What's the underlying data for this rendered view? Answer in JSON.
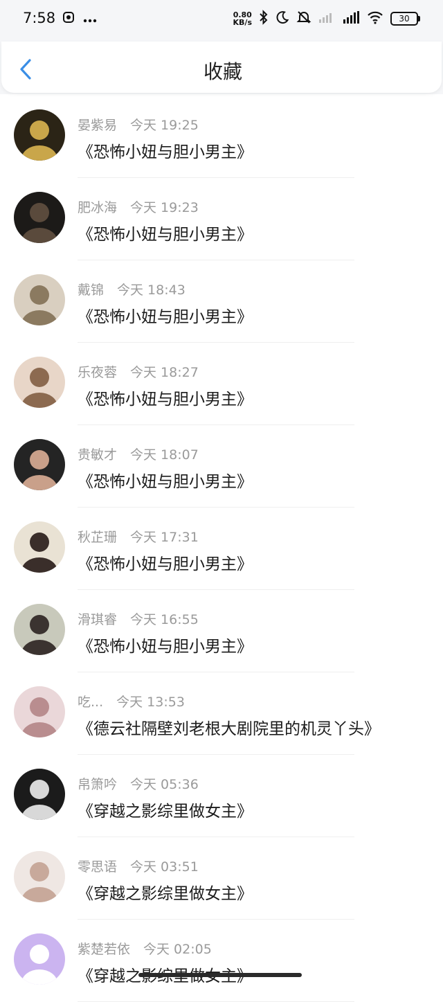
{
  "status_bar": {
    "time": "7:58",
    "net_speed_value": "0.80",
    "net_speed_unit": "KB/s",
    "battery": "30"
  },
  "header": {
    "title": "收藏",
    "back_icon": "chevron-left-icon",
    "accent": "#3a8ee6"
  },
  "favorites": [
    {
      "user": "晏紫易",
      "time": "今天 19:25",
      "book": "《恐怖小妞与胆小男主》",
      "avatar_color": "#2b2416",
      "avatar_accent": "#c9a64a"
    },
    {
      "user": "肥冰海",
      "time": "今天 19:23",
      "book": "《恐怖小妞与胆小男主》",
      "avatar_color": "#1c1a18",
      "avatar_accent": "#5a4a3c"
    },
    {
      "user": "戴锦",
      "time": "今天 18:43",
      "book": "《恐怖小妞与胆小男主》",
      "avatar_color": "#d9cfc0",
      "avatar_accent": "#8b7a60"
    },
    {
      "user": "乐夜蓉",
      "time": "今天 18:27",
      "book": "《恐怖小妞与胆小男主》",
      "avatar_color": "#e8d6c8",
      "avatar_accent": "#8c6a50"
    },
    {
      "user": "贵敏才",
      "time": "今天 18:07",
      "book": "《恐怖小妞与胆小男主》",
      "avatar_color": "#242424",
      "avatar_accent": "#c9a08a"
    },
    {
      "user": "秋芷珊",
      "time": "今天 17:31",
      "book": "《恐怖小妞与胆小男主》",
      "avatar_color": "#e9e2d4",
      "avatar_accent": "#3a2e2a"
    },
    {
      "user": "滑琪睿",
      "time": "今天 16:55",
      "book": "《恐怖小妞与胆小男主》",
      "avatar_color": "#c8c9bb",
      "avatar_accent": "#3b3330"
    },
    {
      "user": "吃...",
      "time": "今天 13:53",
      "book": "《德云社隔壁刘老根大剧院里的机灵丫头》",
      "avatar_color": "#ead7d9",
      "avatar_accent": "#b98d8f"
    },
    {
      "user": "帛箫吟",
      "time": "今天 05:36",
      "book": "《穿越之影综里做女主》",
      "avatar_color": "#1b1b1b",
      "avatar_accent": "#d8d8d8"
    },
    {
      "user": "零思语",
      "time": "今天 03:51",
      "book": "《穿越之影综里做女主》",
      "avatar_color": "#efe7e3",
      "avatar_accent": "#c8a99b"
    },
    {
      "user": "紫楚若依",
      "time": "今天 02:05",
      "book": "《穿越之影综里做女主》",
      "avatar_color": "#cbb4f0",
      "avatar_accent": "#ffffff"
    }
  ]
}
